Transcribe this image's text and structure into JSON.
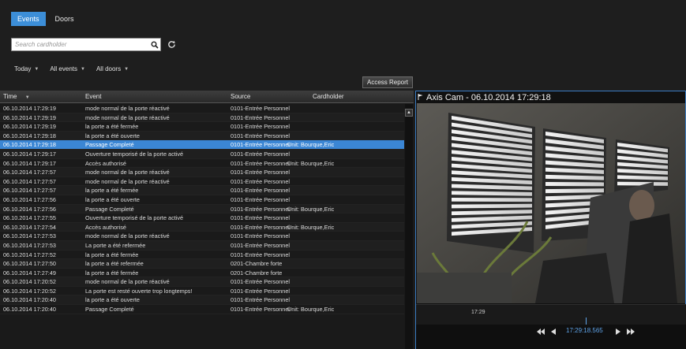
{
  "tabs": [
    {
      "label": "Events",
      "active": true
    },
    {
      "label": "Doors",
      "active": false
    }
  ],
  "search": {
    "placeholder": "Search cardholder",
    "value": ""
  },
  "filters": [
    "Today",
    "All events",
    "All doors"
  ],
  "access_report_label": "Access Report",
  "table": {
    "headers": {
      "time": "Time",
      "event": "Event",
      "source": "Source",
      "cardholder": "Cardholder"
    },
    "rows": [
      {
        "time": "06.10.2014 17:29:19",
        "event": "mode normal de la porte réactivé",
        "source": "0101-Entrée Personnel",
        "cardholder": ""
      },
      {
        "time": "06.10.2014 17:29:19",
        "event": "mode normal de la porte réactivé",
        "source": "0101-Entrée Personnel",
        "cardholder": ""
      },
      {
        "time": "06.10.2014 17:29:19",
        "event": "la porte a été fermée",
        "source": "0101-Entrée Personnel",
        "cardholder": ""
      },
      {
        "time": "06.10.2014 17:29:18",
        "event": "la porte a été ouverte",
        "source": "0101-Entrée Personnel",
        "cardholder": ""
      },
      {
        "time": "06.10.2014 17:29:18",
        "event": "Passage Completé",
        "source": "0101-Entrée Personnel",
        "cardholder": "Unit: Bourque,Eric",
        "selected": true
      },
      {
        "time": "06.10.2014 17:29:17",
        "event": "Ouverture temporisé de la porte activé",
        "source": "0101-Entrée Personnel",
        "cardholder": ""
      },
      {
        "time": "06.10.2014 17:29:17",
        "event": "Accès authorisé",
        "source": "0101-Entrée Personnel",
        "cardholder": "Unit: Bourque,Eric"
      },
      {
        "time": "06.10.2014 17:27:57",
        "event": "mode normal de la porte réactivé",
        "source": "0101-Entrée Personnel",
        "cardholder": ""
      },
      {
        "time": "06.10.2014 17:27:57",
        "event": "mode normal de la porte réactivé",
        "source": "0101-Entrée Personnel",
        "cardholder": ""
      },
      {
        "time": "06.10.2014 17:27:57",
        "event": "la porte a été fermée",
        "source": "0101-Entrée Personnel",
        "cardholder": ""
      },
      {
        "time": "06.10.2014 17:27:56",
        "event": "la porte a été ouverte",
        "source": "0101-Entrée Personnel",
        "cardholder": ""
      },
      {
        "time": "06.10.2014 17:27:56",
        "event": "Passage Completé",
        "source": "0101-Entrée Personnel",
        "cardholder": "Unit: Bourque,Eric"
      },
      {
        "time": "06.10.2014 17:27:55",
        "event": "Ouverture temporisé de la porte activé",
        "source": "0101-Entrée Personnel",
        "cardholder": ""
      },
      {
        "time": "06.10.2014 17:27:54",
        "event": "Accès authorisé",
        "source": "0101-Entrée Personnel",
        "cardholder": "Unit: Bourque,Eric"
      },
      {
        "time": "06.10.2014 17:27:53",
        "event": "mode normal de la porte réactivé",
        "source": "0101-Entrée Personnel",
        "cardholder": ""
      },
      {
        "time": "06.10.2014 17:27:53",
        "event": "La porte a été refermée",
        "source": "0101-Entrée Personnel",
        "cardholder": ""
      },
      {
        "time": "06.10.2014 17:27:52",
        "event": "la porte a été fermée",
        "source": "0101-Entrée Personnel",
        "cardholder": ""
      },
      {
        "time": "06.10.2014 17:27:50",
        "event": "la porte a été refermée",
        "source": "0201-Chambre forte",
        "cardholder": ""
      },
      {
        "time": "06.10.2014 17:27:49",
        "event": "la porte a été fermée",
        "source": "0201-Chambre forte",
        "cardholder": ""
      },
      {
        "time": "06.10.2014 17:20:52",
        "event": "mode normal de la porte réactivé",
        "source": "0101-Entrée Personnel",
        "cardholder": ""
      },
      {
        "time": "06.10.2014 17:20:52",
        "event": "La porte est resté ouverte trop longtemps!",
        "source": "0101-Entrée Personnel",
        "cardholder": ""
      },
      {
        "time": "06.10.2014 17:20:40",
        "event": "la porte a été ouverte",
        "source": "0101-Entrée Personnel",
        "cardholder": ""
      },
      {
        "time": "06.10.2014 17:20:40",
        "event": "Passage Completé",
        "source": "0101-Entrée Personnel",
        "cardholder": "Unit: Bourque,Eric"
      }
    ]
  },
  "camera": {
    "title": "Axis Cam - 06.10.2014 17:29:18",
    "timeline_tick": "17:29",
    "playback_time": "17:29:18.565"
  },
  "colors": {
    "accent": "#3b86d4",
    "background": "#1c1c1c"
  },
  "icons": [
    "search-icon",
    "refresh-icon",
    "chevron-down-icon",
    "play-icon",
    "rewind-icon",
    "fast-forward-icon",
    "step-back-icon",
    "camera-flag-icon"
  ]
}
